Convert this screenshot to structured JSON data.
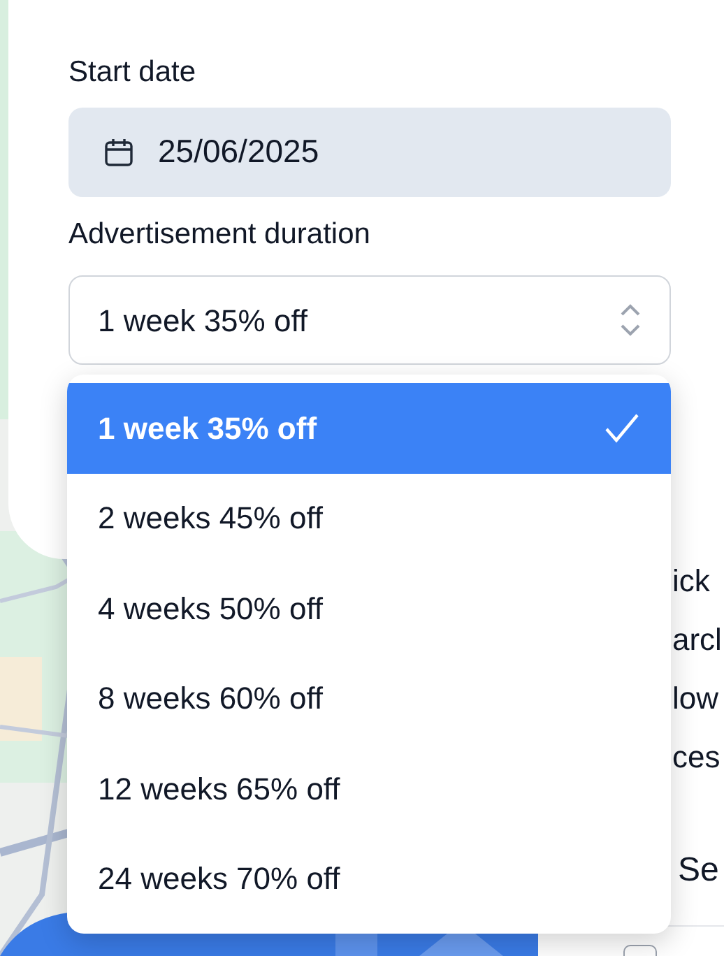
{
  "form": {
    "start_date_label": "Start date",
    "start_date": "25/06/2025",
    "duration_label": "Advertisement duration",
    "duration_value": "1 week 35% off"
  },
  "dropdown": {
    "options": [
      {
        "label": "1 week 35% off",
        "selected": true
      },
      {
        "label": "2 weeks 45% off",
        "selected": false
      },
      {
        "label": "4 weeks 50% off",
        "selected": false
      },
      {
        "label": "8 weeks 60% off",
        "selected": false
      },
      {
        "label": "12 weeks 65% off",
        "selected": false
      },
      {
        "label": "24 weeks 70% off",
        "selected": false
      }
    ]
  },
  "side_panel": {
    "lines": [
      "ick",
      "arcl",
      "low",
      "ces"
    ],
    "heading": "Se",
    "checkbox": {
      "checked": false
    }
  }
}
